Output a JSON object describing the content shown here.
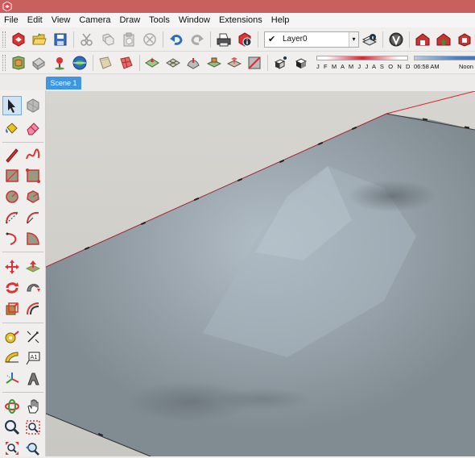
{
  "colors": {
    "titlebar": "#c7605f",
    "scene_tab": "#3f96e3",
    "viewport_background": "#d0cfca",
    "terrain": "#8a949b",
    "terrain_highlight": "#b7c3cc",
    "red_axis": "#d9222a"
  },
  "menu": {
    "file": "File",
    "edit": "Edit",
    "view": "View",
    "camera": "Camera",
    "draw": "Draw",
    "tools": "Tools",
    "window": "Window",
    "extensions": "Extensions",
    "help": "Help"
  },
  "toolbar1": {
    "icons": [
      "getting-started-icon",
      "open-icon",
      "save-icon",
      "cut-icon",
      "copy-icon",
      "paste-icon",
      "erase-selection-icon",
      "undo-icon",
      "redo-icon",
      "print-icon",
      "model-info-icon"
    ],
    "layer": {
      "check": "✔",
      "name": "Layer0",
      "arrow": "▾"
    },
    "right_icons": [
      "layer-manager-icon",
      "vray-icon",
      "warehouse-icon",
      "share-model-icon",
      "extension-warehouse-icon"
    ]
  },
  "toolbar2": {
    "icons": [
      "component-icon",
      "import-icon",
      "map-location-icon",
      "geo-toggle-terrain-icon",
      "section-plane-icon",
      "section-display-icon",
      "sandbox-from-contours-icon",
      "sandbox-from-scratch-icon",
      "smoove-icon",
      "stamp-icon",
      "drape-icon",
      "flip-edge-icon",
      "shadows-icon",
      "fog-icon"
    ],
    "months": "J F M A M J J A S O N D",
    "time_left": "06:58 AM",
    "time_right": "Noon"
  },
  "scene": {
    "tab_label": "Scene 1"
  },
  "tools": [
    "select-arrow-icon",
    "make-component-icon",
    "paint-bucket-icon",
    "eraser-icon",
    "line-pencil-icon",
    "freehand-icon",
    "rectangle-icon",
    "rotated-rectangle-icon",
    "circle-icon",
    "polygon-icon",
    "arc-icon",
    "two-point-arc-icon",
    "three-point-arc-icon",
    "pie-icon",
    "move-icon",
    "push-pull-icon",
    "rotate-icon",
    "follow-me-icon",
    "scale-icon",
    "offset-icon",
    "tape-measure-icon",
    "dimension-icon",
    "protractor-icon",
    "text-icon",
    "axes-icon",
    "3d-text-icon",
    "orbit-icon",
    "pan-icon",
    "zoom-icon",
    "zoom-window-icon",
    "zoom-extents-icon",
    "previous-view-icon"
  ],
  "tool_extra": {
    "text_tool_label": "A1"
  }
}
